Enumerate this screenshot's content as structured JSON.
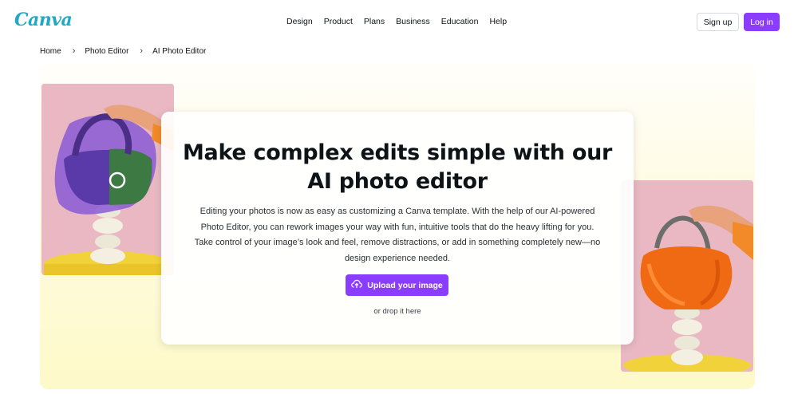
{
  "header": {
    "logo": "Canva",
    "nav": [
      "Design",
      "Product",
      "Plans",
      "Business",
      "Education",
      "Help"
    ],
    "signup_label": "Sign up",
    "login_label": "Log in"
  },
  "breadcrumb": {
    "items": [
      "Home",
      "Photo Editor",
      "AI Photo Editor"
    ]
  },
  "hero": {
    "title_line1": "Make complex edits simple with our",
    "title_line2": "AI photo editor",
    "description": "Editing your photos is now as easy as customizing a Canva template. With the help of our AI-powered Photo Editor, you can rework images your way with fun, intuitive tools that do the heavy lifting for you. Take control of your image’s look and feel, remove distractions, or add in something completely new—no design experience needed.",
    "upload_label": "Upload your image",
    "upload_icon": "cloud-upload-icon",
    "drop_text": "or drop it here"
  },
  "colors": {
    "brand_purple": "#8b3dff",
    "logo_teal": "#1fa9c4",
    "photo_background": "#e9b8c3",
    "hero_background": "#fdf9c8"
  }
}
